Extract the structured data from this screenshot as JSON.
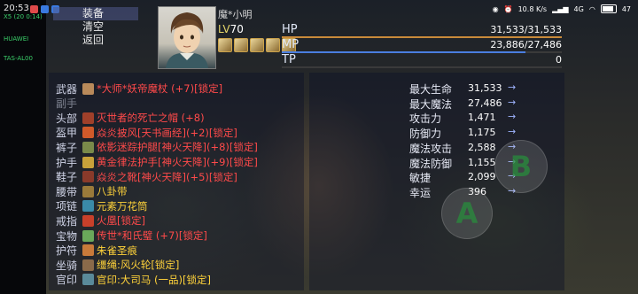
{
  "status_bar": {
    "time": "20:53",
    "net_speed": "10.8 K/s",
    "network": "4G",
    "battery": "47"
  },
  "device_info": [
    "X5 (20 0:14)",
    "HUAWEI",
    "TAS-AL00"
  ],
  "menu": {
    "items": [
      "装备",
      "清空",
      "返回"
    ],
    "selected": 0
  },
  "character": {
    "name": "魔*小明",
    "level_label": "LV",
    "level": "70",
    "stats": [
      {
        "label": "HP",
        "value": "31,533/31,533",
        "fraction": 1.0,
        "color": "#c98a3a"
      },
      {
        "label": "MP",
        "value": "23,886/27,486",
        "fraction": 0.869,
        "color": "#4a7ee0"
      },
      {
        "label": "TP",
        "value": "0",
        "fraction": 0.0,
        "color": "#44aa55"
      }
    ]
  },
  "equipment": [
    {
      "slot": "武器",
      "text": "*大师*妖帝魔杖 (+7)[锁定]",
      "color": "#ff4a4a",
      "icon_color": "#b98a5a",
      "slot_dim": false
    },
    {
      "slot": "副手",
      "text": "",
      "color": "#ffffff",
      "icon_color": "",
      "slot_dim": true
    },
    {
      "slot": "头部",
      "text": "灭世者的死亡之帽 (+8)",
      "color": "#ff4a4a",
      "icon_color": "#a0402a",
      "slot_dim": false
    },
    {
      "slot": "盔甲",
      "text": "焱炎披风[天书画经](+2)[锁定]",
      "color": "#ff4a4a",
      "icon_color": "#d05a2a",
      "slot_dim": false
    },
    {
      "slot": "裤子",
      "text": "依影迷踪护腿[神火天降](+8)[锁定]",
      "color": "#ff4a4a",
      "icon_color": "#7a8a4a",
      "slot_dim": false
    },
    {
      "slot": "护手",
      "text": "黄金律法护手[神火天降](+9)[锁定]",
      "color": "#ff4a4a",
      "icon_color": "#c8a23a",
      "slot_dim": false
    },
    {
      "slot": "鞋子",
      "text": "焱炎之靴[神火天降](+5)[锁定]",
      "color": "#ff4a4a",
      "icon_color": "#8a3a2a",
      "slot_dim": false
    },
    {
      "slot": "腰带",
      "text": "八卦带",
      "color": "#ffd23a",
      "icon_color": "#9a7a3a",
      "slot_dim": false
    },
    {
      "slot": "项链",
      "text": "元素万花筒",
      "color": "#ffd23a",
      "icon_color": "#3a8aa8",
      "slot_dim": false
    },
    {
      "slot": "戒指",
      "text": "火凰[锁定]",
      "color": "#ff4a4a",
      "icon_color": "#c8402a",
      "slot_dim": false
    },
    {
      "slot": "宝物",
      "text": "传世*和氏璧 (+7)[锁定]",
      "color": "#ff4a4a",
      "icon_color": "#6aa85a",
      "slot_dim": false
    },
    {
      "slot": "护符",
      "text": "朱雀圣痕",
      "color": "#ffd23a",
      "icon_color": "#c87a3a",
      "slot_dim": false
    },
    {
      "slot": "坐骑",
      "text": "缰绳:风火轮[锁定]",
      "color": "#ffd23a",
      "icon_color": "#8a6a4a",
      "slot_dim": false
    },
    {
      "slot": "官印",
      "text": "官印:大司马 (一品)[锁定]",
      "color": "#ffd23a",
      "icon_color": "#5a8a9a",
      "slot_dim": false
    }
  ],
  "attributes": [
    {
      "label": "最大生命",
      "value": "31,533",
      "arrow": "→"
    },
    {
      "label": "最大魔法",
      "value": "27,486",
      "arrow": "→"
    },
    {
      "label": "攻击力",
      "value": "1,471",
      "arrow": "→"
    },
    {
      "label": "防御力",
      "value": "1,175",
      "arrow": "→"
    },
    {
      "label": "魔法攻击",
      "value": "2,588",
      "arrow": "→"
    },
    {
      "label": "魔法防御",
      "value": "1,155",
      "arrow": "→"
    },
    {
      "label": "敏捷",
      "value": "2,099",
      "arrow": "→"
    },
    {
      "label": "幸运",
      "value": "396",
      "arrow": "→"
    }
  ],
  "controls": {
    "a_label": "A",
    "b_label": "B"
  }
}
